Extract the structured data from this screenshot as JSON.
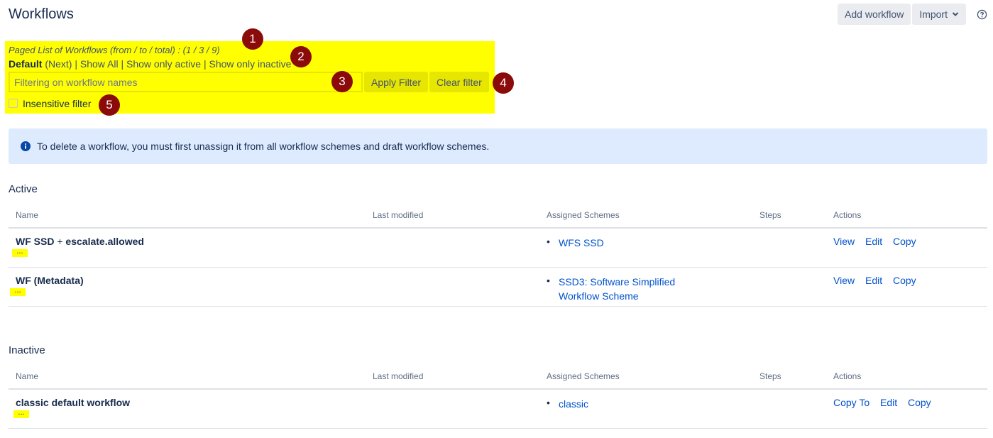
{
  "header": {
    "title": "Workflows",
    "add_workflow_label": "Add workflow",
    "import_label": "Import"
  },
  "filter": {
    "paged_text": "Paged List of Workflows (from / to / total) : (1 / 3 / 9)",
    "default_label": "Default",
    "next_label": "(Next)",
    "show_all_label": "Show All",
    "show_active_label": "Show only active",
    "show_inactive_label": "Show only inactive",
    "separator": "|",
    "input_placeholder": "Filtering on workflow names",
    "input_value": "",
    "apply_label": "Apply Filter",
    "clear_label": "Clear filter",
    "insensitive_label": "Insensitive filter"
  },
  "markers": [
    "1",
    "2",
    "3",
    "4",
    "5"
  ],
  "info": {
    "text": "To delete a workflow, you must first unassign it from all workflow schemes and draft workflow schemes."
  },
  "columns": {
    "name": "Name",
    "last_modified": "Last modified",
    "assigned_schemes": "Assigned Schemes",
    "steps": "Steps",
    "actions": "Actions"
  },
  "active": {
    "title": "Active",
    "rows": [
      {
        "name_a": "WF SSD",
        "name_plus": " + ",
        "name_b": "escalate.allowed",
        "ellipsis": "...",
        "schemes": [
          "WFS SSD"
        ],
        "actions": [
          "View",
          "Edit",
          "Copy"
        ]
      },
      {
        "name_a": "WF (Metadata)",
        "ellipsis": "...",
        "schemes": [
          "SSD3: Software Simplified Workflow Scheme"
        ],
        "actions": [
          "View",
          "Edit",
          "Copy"
        ]
      }
    ]
  },
  "inactive": {
    "title": "Inactive",
    "rows": [
      {
        "name_a": "classic default workflow",
        "ellipsis": "...",
        "schemes": [
          "classic"
        ],
        "actions": [
          "Copy To",
          "Edit",
          "Copy"
        ]
      }
    ]
  },
  "colors": {
    "highlight": "#ffff00",
    "marker": "#8b0a0a",
    "link": "#0052cc",
    "banner": "#deebff"
  }
}
